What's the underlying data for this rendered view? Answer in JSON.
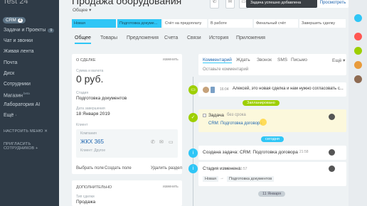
{
  "sidebar": {
    "logo": "Test 24",
    "crm": {
      "label": "CRM",
      "count": "4"
    },
    "items": [
      {
        "label": "Задачи и Проекты",
        "badge": "9"
      },
      {
        "label": "Чат и звонки",
        "badge": ""
      },
      {
        "label": "Живая лента",
        "badge": ""
      },
      {
        "label": "Почта",
        "badge": ""
      },
      {
        "label": "Диск",
        "badge": ""
      },
      {
        "label": "Сотрудники",
        "badge": ""
      },
      {
        "label": "Магазин",
        "badge": "beta"
      },
      {
        "label": "Лаборатория AI",
        "badge": ""
      },
      {
        "label": "Ещё ·",
        "badge": ""
      }
    ],
    "settings_menu": "НАСТРОИТЬ МЕНЮ ✕",
    "invite": "ПРИГЛАСИТЬ СОТРУДНИКОВ +"
  },
  "header": {
    "title": "Продажа оборудования",
    "category": "Общее ▾",
    "toast": "Задача успешно добавлена",
    "view_button": "Просмотреть"
  },
  "stages": [
    {
      "label": "Новая",
      "color": "#2fc6f6",
      "text": "#1c4a5a"
    },
    {
      "label": "Подготовка докуме...",
      "color": "#2fc6f6",
      "text": "#1c4a5a"
    },
    {
      "label": "Счёт на предоплату",
      "color": "#ffffff",
      "text": "#555555"
    },
    {
      "label": "В работе",
      "color": "#ffffff",
      "text": "#555555"
    },
    {
      "label": "Финальный счёт",
      "color": "#ffffff",
      "text": "#555555"
    },
    {
      "label": "Завершить сделку",
      "color": "#ffffff",
      "text": "#555555"
    }
  ],
  "tabs": [
    "Общее",
    "Товары",
    "Предложения",
    "Счета",
    "Связи",
    "История",
    "Приложения"
  ],
  "deal_card": {
    "heading": "О СДЕЛКЕ",
    "edit": "изменить",
    "amount_label": "Сумма и валюта",
    "amount": "0 руб.",
    "stage_label": "Стадия",
    "stage": "Подготовка документов",
    "close_label": "Дата завершения",
    "close": "18 Января 2019",
    "client_label": "Клиент",
    "company_label": "Компания",
    "company": "ЖКХ 365",
    "company_type": "Клиент: Другое",
    "select_field": "Выбрать поле",
    "create_field": "Создать поле",
    "delete_section": "Удалить раздел"
  },
  "extra_card": {
    "heading": "ДОПОЛНИТЕЛЬНО",
    "edit": "изменить",
    "type_label": "Тип сделки",
    "type": "Продажа"
  },
  "activity": {
    "tabs": [
      "Комментарий",
      "Ждать",
      "Звонок",
      "SMS",
      "Письмо",
      "Ещё ▾"
    ],
    "placeholder": "Оставьте комментарий",
    "comment_time": "16:04",
    "comment_text": "Алексей, это новая сделка и нам нужно согласовать с...",
    "planned_pill": "Запланировано",
    "task_label": "Задача",
    "task_deadline": "без срока",
    "task_entity": "CRM: Подготовка договора",
    "today_pill": "сегодня",
    "created_text": "Создана задача: CRM: Подготовка договора",
    "created_time": "21:58",
    "stage_changed": "Стадия изменена",
    "stage_time": "21:57",
    "stage_from": "Новая",
    "stage_to": "Подготовка документов",
    "date_pill": "11 Января"
  },
  "colors": {
    "accent": "#2fc6f6",
    "green": "#9dcf00",
    "yellow": "#ffd84a",
    "blue_info": "#2fc6f6",
    "gray_icon": "#8e9aa3"
  }
}
